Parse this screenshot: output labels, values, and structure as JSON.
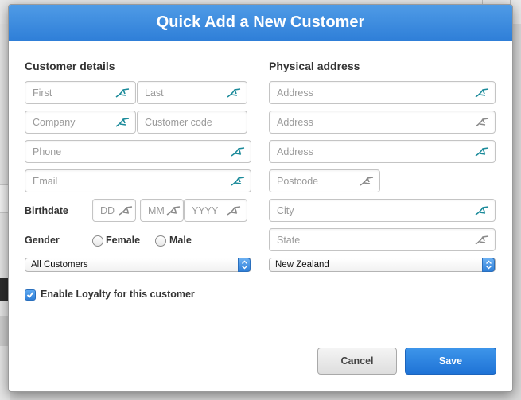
{
  "modal": {
    "title": "Quick Add a New Customer"
  },
  "customer_details": {
    "title": "Customer details",
    "first_placeholder": "First",
    "last_placeholder": "Last",
    "company_placeholder": "Company",
    "customer_code_placeholder": "Customer code",
    "phone_placeholder": "Phone",
    "email_placeholder": "Email",
    "birthdate_label": "Birthdate",
    "dd_placeholder": "DD",
    "mm_placeholder": "MM",
    "yyyy_placeholder": "YYYY",
    "gender_label": "Gender",
    "gender_options": [
      "Female",
      "Male"
    ],
    "customer_group_selected": "All Customers",
    "loyalty_label": "Enable Loyalty for this customer",
    "loyalty_checked": true
  },
  "physical_address": {
    "title": "Physical address",
    "address1_placeholder": "Address",
    "address2_placeholder": "Address",
    "address3_placeholder": "Address",
    "postcode_placeholder": "Postcode",
    "city_placeholder": "City",
    "state_placeholder": "State",
    "country_selected": "New Zealand"
  },
  "actions": {
    "cancel_label": "Cancel",
    "save_label": "Save"
  },
  "colors": {
    "header_blue": "#2f7fd8",
    "autofill_icon_teal": "#1a8a9a",
    "autofill_icon_gray": "#8a8a8a"
  }
}
